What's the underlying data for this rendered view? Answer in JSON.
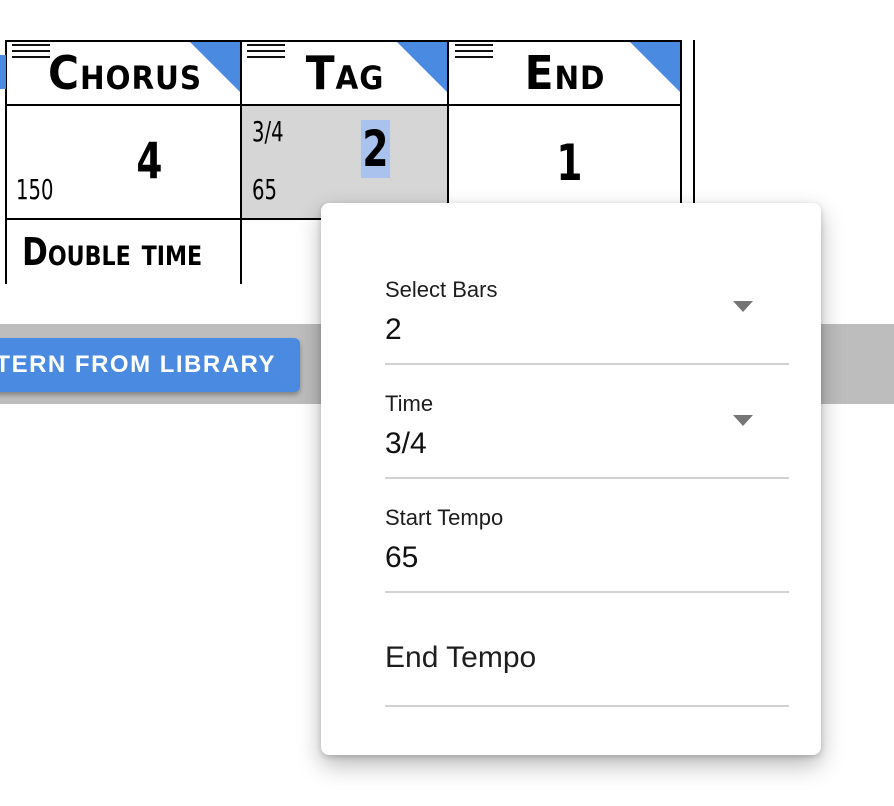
{
  "grid": {
    "sections": [
      {
        "title": "Chorus",
        "bars": "4",
        "tempo": "150",
        "time_sig": "",
        "note": "Double time"
      },
      {
        "title": "Tag",
        "bars": "2",
        "tempo": "65",
        "time_sig": "3/4",
        "note": ""
      },
      {
        "title": "End",
        "bars": "1",
        "tempo": "",
        "time_sig": "",
        "note": ""
      }
    ],
    "selected_section": 1
  },
  "toolbar": {
    "library_button_label": "TERN FROM LIBRARY"
  },
  "popup": {
    "fields": [
      {
        "label": "Select Bars",
        "value": "2",
        "type": "select"
      },
      {
        "label": "Time",
        "value": "3/4",
        "type": "select"
      },
      {
        "label": "Start Tempo",
        "value": "65",
        "type": "input"
      },
      {
        "label": "End Tempo",
        "value": "",
        "type": "input"
      }
    ]
  },
  "colors": {
    "accent": "#4a8ae0",
    "selected_cell": "#d6d6d6",
    "highlight": "#a9c3ee",
    "toolbar": "#bdbdbd"
  }
}
